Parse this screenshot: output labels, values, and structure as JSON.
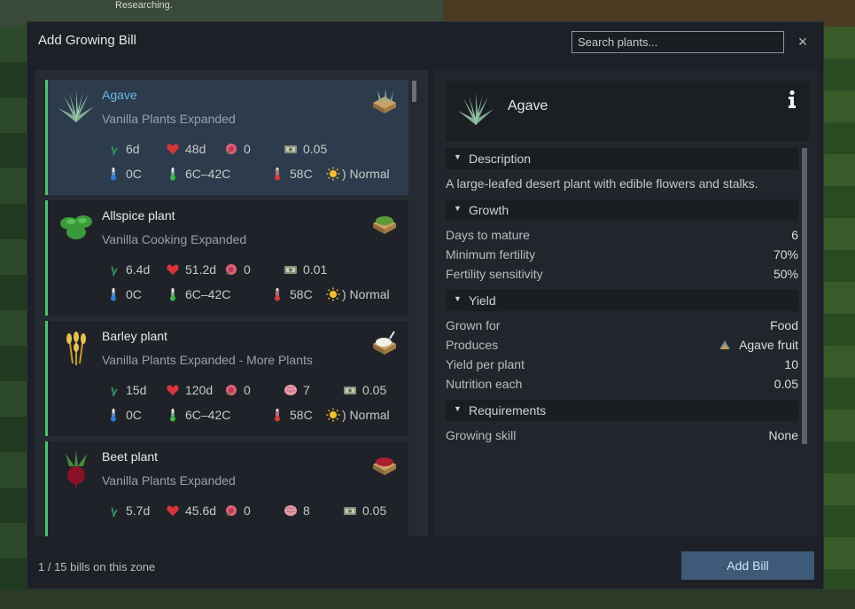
{
  "background": {
    "label": "Researching."
  },
  "dialog": {
    "title": "Add Growing Bill",
    "search_placeholder": "Search plants...",
    "close_label": "×"
  },
  "plants": [
    {
      "name": "Agave",
      "mod": "Vanilla Plants Expanded",
      "grow_days": "6d",
      "lifespan": "48d",
      "harvest": "0",
      "value": "0.05",
      "min_temp": "0C",
      "opt_temp": "6C–42C",
      "max_temp": "58C",
      "light": ") Normal"
    },
    {
      "name": "Allspice plant",
      "mod": "Vanilla Cooking Expanded",
      "grow_days": "6.4d",
      "lifespan": "51.2d",
      "harvest": "0",
      "value": "0.01",
      "min_temp": "0C",
      "opt_temp": "6C–42C",
      "max_temp": "58C",
      "light": ") Normal"
    },
    {
      "name": "Barley plant",
      "mod": "Vanilla Plants Expanded - More Plants",
      "grow_days": "15d",
      "lifespan": "120d",
      "harvest": "0",
      "brain": "7",
      "value": "0.05",
      "min_temp": "0C",
      "opt_temp": "6C–42C",
      "max_temp": "58C",
      "light": ") Normal"
    },
    {
      "name": "Beet plant",
      "mod": "Vanilla Plants Expanded",
      "grow_days": "5.7d",
      "lifespan": "45.6d",
      "harvest": "0",
      "brain": "8",
      "value": "0.05"
    }
  ],
  "detail": {
    "title": "Agave",
    "sections": {
      "description": "Description",
      "growth": "Growth",
      "yield": "Yield",
      "requirements": "Requirements"
    },
    "description": "A large-leafed desert plant with edible flowers and stalks.",
    "growth": {
      "days_label": "Days to mature",
      "days_value": "6",
      "fert_label": "Minimum fertility",
      "fert_value": "70%",
      "sens_label": "Fertility sensitivity",
      "sens_value": "50%"
    },
    "yield": {
      "grown_label": "Grown for",
      "grown_value": "Food",
      "produces_label": "Produces",
      "produces_value": "Agave fruit",
      "per_plant_label": "Yield per plant",
      "per_plant_value": "10",
      "nutrition_label": "Nutrition each",
      "nutrition_value": "0.05"
    },
    "requirements": {
      "skill_label": "Growing skill",
      "skill_value": "None"
    }
  },
  "footer": {
    "bills_status": "1 / 15 bills on this zone",
    "add_bill_label": "Add Bill"
  },
  "colors": {
    "accent_green": "#4ec26a",
    "selected_name": "#6fb6e8",
    "add_button": "#3e5a78"
  }
}
